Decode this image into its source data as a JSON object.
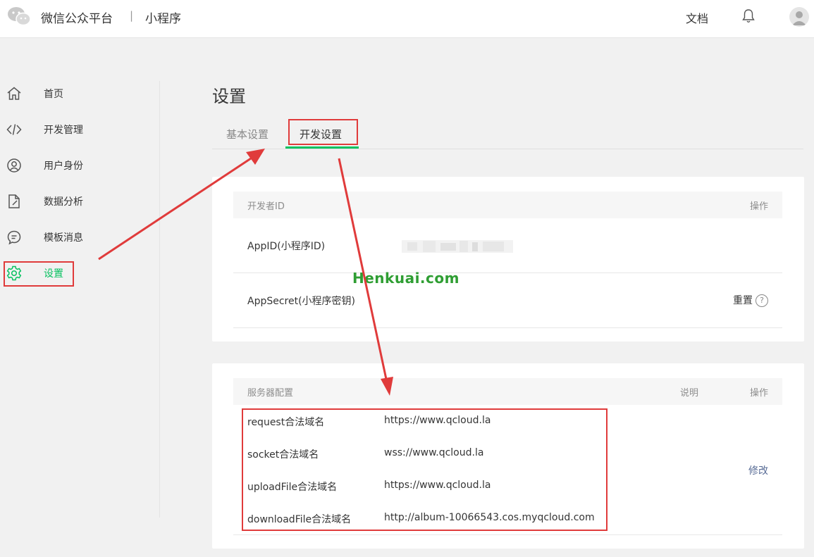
{
  "topbar": {
    "brand": "微信公众平台",
    "separator": "|",
    "product": "小程序",
    "docs": "文档"
  },
  "sidebar": {
    "items": [
      {
        "label": "首页",
        "icon": "home-icon"
      },
      {
        "label": "开发管理",
        "icon": "code-icon"
      },
      {
        "label": "用户身份",
        "icon": "user-icon"
      },
      {
        "label": "数据分析",
        "icon": "chart-doc-icon"
      },
      {
        "label": "模板消息",
        "icon": "message-icon"
      },
      {
        "label": "设置",
        "icon": "gear-icon",
        "active": true
      }
    ]
  },
  "main": {
    "title": "设置",
    "tabs": [
      {
        "label": "基本设置",
        "active": false
      },
      {
        "label": "开发设置",
        "active": true
      }
    ]
  },
  "developer_card": {
    "header": "开发者ID",
    "action_header": "操作",
    "appid_label": "AppID(小程序ID)",
    "appsecret_label": "AppSecret(小程序密钥)",
    "reset": "重置",
    "help": "?"
  },
  "server_card": {
    "header": "服务器配置",
    "desc_header": "说明",
    "action_header": "操作",
    "rows": [
      {
        "label": "request合法域名",
        "value": "https://www.qcloud.la"
      },
      {
        "label": "socket合法域名",
        "value": "wss://www.qcloud.la"
      },
      {
        "label": "uploadFile合法域名",
        "value": "https://www.qcloud.la"
      },
      {
        "label": "downloadFile合法域名",
        "value": "http://album-10066543.cos.myqcloud.com"
      }
    ],
    "modify": "修改"
  },
  "watermark": "Henkuai.com",
  "colors": {
    "accent_green": "#07c160",
    "link_blue": "#576b95",
    "annotation_red": "#e03b3b"
  }
}
